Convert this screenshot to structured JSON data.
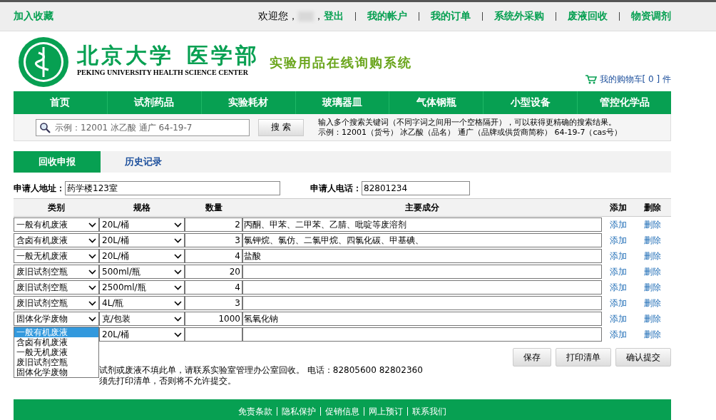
{
  "top_bar": {
    "favorite": "加入收藏",
    "welcome": "欢迎您，",
    "comma": "，",
    "logout": "登出",
    "links": [
      "我的帐户",
      "我的订单",
      "系统外采购",
      "废液回收",
      "物资调剂"
    ]
  },
  "header": {
    "name_part1": "北京大学",
    "name_part2": "医学部",
    "english": "PEKING UNIVERSITY HEALTH SCIENCE CENTER",
    "system_title": "实验用品在线询购系统",
    "cart": "我的购物车[ 0 ] 件"
  },
  "nav": [
    "首页",
    "试剂药品",
    "实验耗材",
    "玻璃器皿",
    "气体钢瓶",
    "小型设备",
    "管控化学品"
  ],
  "search": {
    "placeholder": "示例：12001 冰乙酸 通广 64-19-7",
    "button": "搜 索",
    "hint_lines": [
      "输入多个搜索关键词（不同字词之间用一个空格隔开），可以获得更精确的搜索结果。",
      "示例：12001（货号） 冰乙酸（品名） 通广（品牌或供货商简称） 64-19-7（cas号）"
    ]
  },
  "tabs": [
    {
      "label": "回收申报",
      "selected": true
    },
    {
      "label": "历史记录",
      "selected": false
    }
  ],
  "form": {
    "address_label": "申请人地址：",
    "address": "药学楼123室",
    "phone_label": "申请人电话：",
    "phone": "82801234"
  },
  "table": {
    "columns": [
      "类别",
      "规格",
      "数量",
      "主要成分",
      "添加",
      "删除"
    ],
    "rows": [
      {
        "category": "一般有机废液",
        "spec": "20L/桶",
        "quantity": "2",
        "components": "丙酮、甲苯、二甲苯、乙腈、吡啶等废溶剂",
        "add": "添加",
        "delete": "删除"
      },
      {
        "category": "含卤有机废液",
        "spec": "20L/桶",
        "quantity": "3",
        "components": "氯钾烷、氯仿、二氯甲烷、四氯化碳、甲基碘、",
        "add": "添加",
        "delete": "删除"
      },
      {
        "category": "一般无机废液",
        "spec": "20L/桶",
        "quantity": "4",
        "components": "盐酸",
        "add": "添加",
        "delete": "删除"
      },
      {
        "category": "废旧试剂空瓶",
        "spec": "500ml/瓶",
        "quantity": "20",
        "add": "添加",
        "delete": "删除"
      },
      {
        "category": "废旧试剂空瓶",
        "spec": "2500ml/瓶",
        "quantity": "4",
        "add": "添加",
        "delete": "删除"
      },
      {
        "category": "废旧试剂空瓶",
        "spec": "4L/瓶",
        "quantity": "3",
        "add": "添加",
        "delete": "删除"
      },
      {
        "category": "固体化学废物",
        "spec": "克/包装",
        "quantity": "1000",
        "components": "氢氧化钠",
        "add": "添加",
        "delete": "删除"
      },
      {
        "spec": "20L/桶",
        "add": "添加",
        "delete": "删除",
        "dropdown": [
          {
            "label": "一般有机废液",
            "selected": true
          },
          {
            "label": "含卤有机废液",
            "selected": false
          },
          {
            "label": "一般无机废液",
            "selected": false
          },
          {
            "label": "废旧试剂空瓶",
            "selected": false
          },
          {
            "label": "固体化学废物",
            "selected": false
          }
        ]
      }
    ]
  },
  "buttons": [
    "保存",
    "打印清单",
    "确认提交"
  ],
  "notes": [
    "试剂或废液不填此单，请联系实验室管理办公室回收。 电话：82805600 82802360",
    "须先打印清单，否则将不允许提交。"
  ],
  "footer": [
    "免责条款",
    "隐私保护",
    "促销信息",
    "网上预订",
    "联系我们"
  ]
}
